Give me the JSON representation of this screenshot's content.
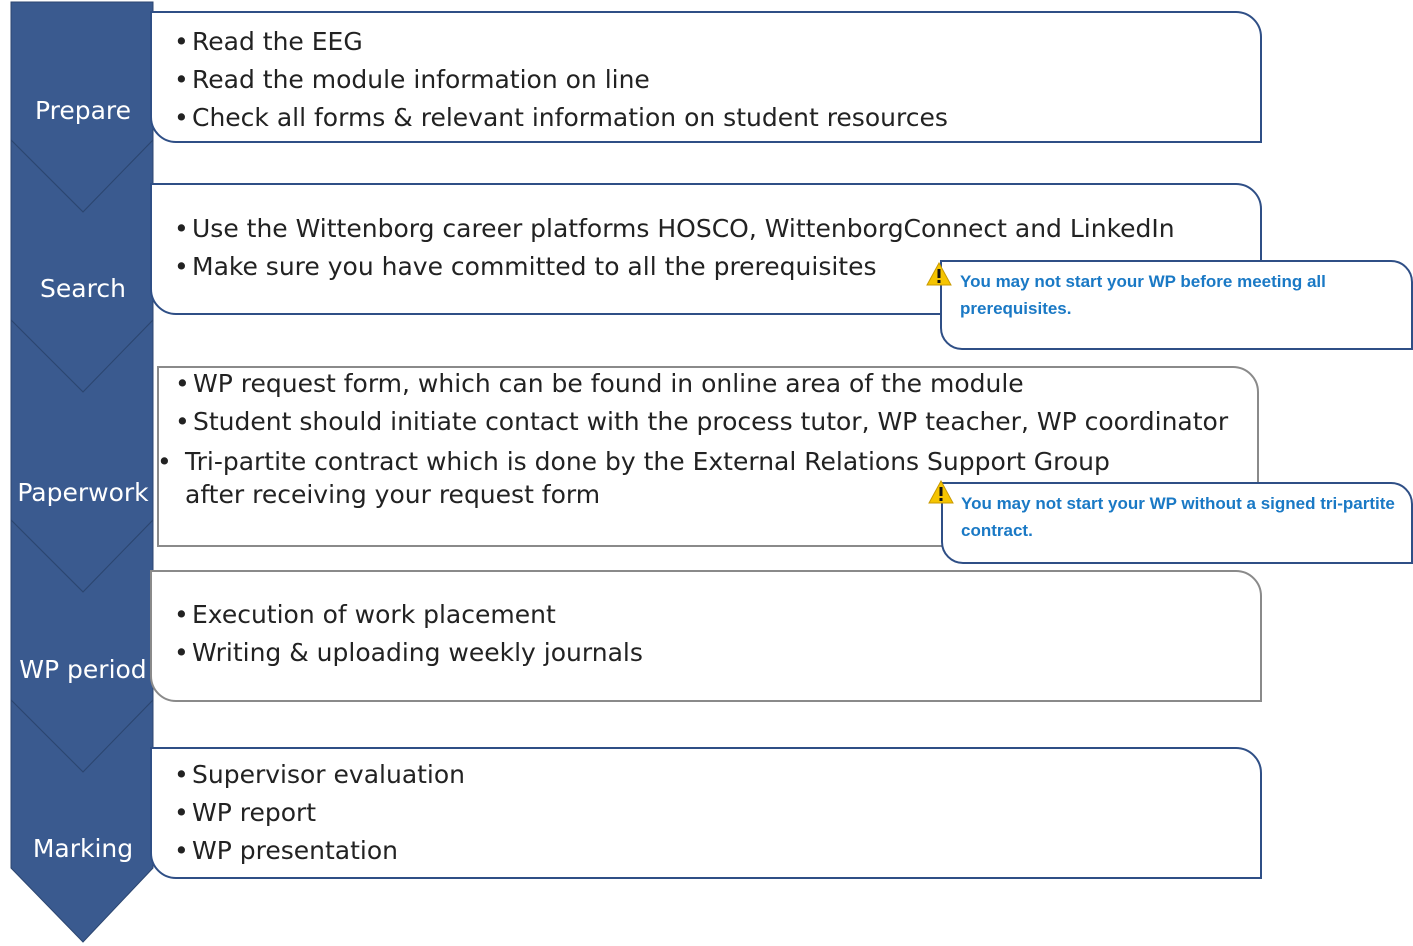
{
  "colors": {
    "chevron": "#3a5a8f",
    "border_blue": "#2f4f86",
    "border_grey": "#8a8a8a",
    "note_text": "#1a79c5",
    "warning_fill": "#f5c400"
  },
  "stages": [
    {
      "label": "Prepare",
      "items": [
        "Read the EEG",
        "Read the module information on line",
        "Check all forms  & relevant information on student resources"
      ]
    },
    {
      "label": "Search",
      "items": [
        "Use the Wittenborg career platforms HOSCO, WittenborgConnect and LinkedIn",
        "Make sure you have committed to all the prerequisites"
      ],
      "note": {
        "icon": "warning-icon",
        "text": "You may not start your WP before meeting all prerequisites."
      }
    },
    {
      "label": "Paperwork",
      "items": [
        "WP request form, which can be found in online area of the module",
        "Student should initiate contact with the process tutor, WP teacher, WP coordinator",
        "Tri-partite contract which is done by the External Relations Support Group after receiving your request form"
      ],
      "note": {
        "icon": "warning-icon",
        "text": "You may not start your WP without a signed tri-partite contract."
      }
    },
    {
      "label": "WP period",
      "items": [
        "Execution of work placement",
        "Writing & uploading weekly journals"
      ]
    },
    {
      "label": "Marking",
      "items": [
        "Supervisor evaluation",
        "WP report",
        "WP presentation"
      ]
    }
  ]
}
